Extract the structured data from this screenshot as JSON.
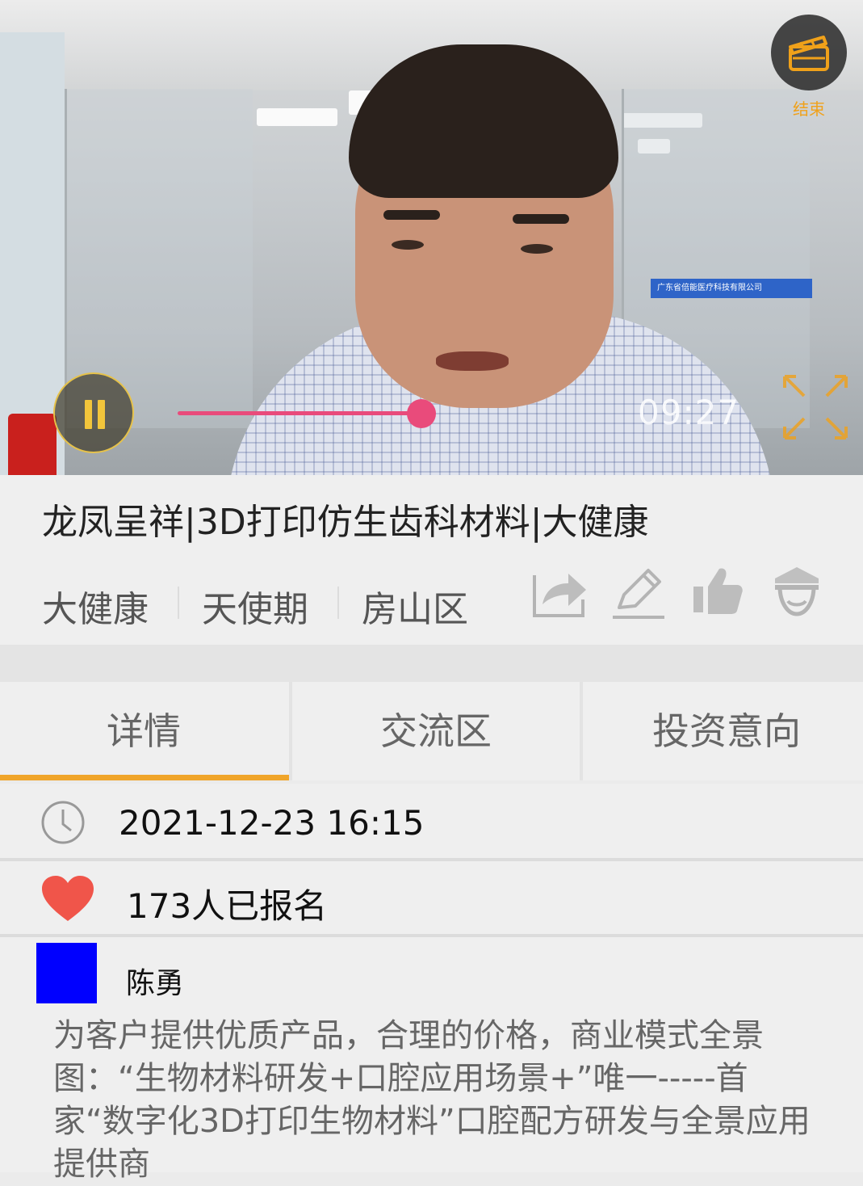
{
  "player": {
    "end_label": "结束",
    "elapsed_time": "09:27",
    "progress_percent": 54,
    "state": "playing"
  },
  "video": {
    "sign_text": "广东省倍能医疗科技有限公司"
  },
  "project": {
    "title": "龙凤呈祥|3D打印仿生齿科材料|大健康",
    "tags": [
      "大健康",
      "天使期",
      "房山区"
    ]
  },
  "actions": [
    {
      "icon": "share-icon"
    },
    {
      "icon": "edit-icon"
    },
    {
      "icon": "thumbs-up-icon"
    },
    {
      "icon": "officer-icon"
    }
  ],
  "tabs": [
    {
      "label": "详情",
      "active": true
    },
    {
      "label": "交流区",
      "active": false
    },
    {
      "label": "投资意向",
      "active": false
    }
  ],
  "details": {
    "datetime": "2021-12-23 16:15",
    "signup_count_text": "173人已报名"
  },
  "author": {
    "name": "陈勇",
    "avatar_color": "#0000ff",
    "description": "为客户提供优质产品，合理的价格，商业模式全景图：“生物材料研发+口腔应用场景+”唯一-----首家“数字化3D打印生物材料”口腔配方研发与全景应用提供商"
  },
  "colors": {
    "accent": "#f0a52a",
    "progress": "#e94b7b",
    "heart": "#f0554a"
  }
}
